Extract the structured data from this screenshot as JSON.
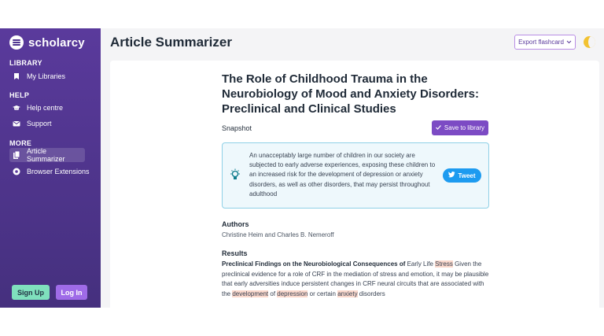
{
  "brand": {
    "name": "scholarcy"
  },
  "sidebar": {
    "library_head": "LIBRARY",
    "help_head": "HELP",
    "more_head": "MORE",
    "items": [
      {
        "label": "My Libraries",
        "icon": "bookmark-icon"
      },
      {
        "label": "Help centre",
        "icon": "graduation-cap-icon"
      },
      {
        "label": "Support",
        "icon": "mail-icon"
      },
      {
        "label": "Article Summarizer",
        "icon": "documents-icon",
        "active": true
      },
      {
        "label": "Browser Extensions",
        "icon": "chrome-icon"
      }
    ],
    "signup_label": "Sign Up",
    "login_label": "Log In"
  },
  "header": {
    "title": "Article Summarizer",
    "export_label": "Export flashcard",
    "theme_icon": "moon-icon"
  },
  "article": {
    "title": "The Role of Childhood Trauma in the Neurobiology of Mood and Anxiety Disorders: Preclinical and Clinical Studies",
    "snapshot_label": "Snapshot",
    "save_label": "Save to library",
    "snapshot_text": "An unacceptably large number of children in our society are subjected to early adverse experiences, exposing these children to an increased risk for the development of depression or anxiety disorders, as well as other disorders, that may persist throughout adulthood",
    "tweet_label": "Tweet",
    "authors_head": "Authors",
    "authors": "Christine Heim and Charles B. Nemeroff",
    "results_head": "Results",
    "results": {
      "bold": "Preclinical Findings on the Neurobiological Consequences of",
      "t1": " Early Life ",
      "h1": "Stress",
      "t2": " Given the preclinical evidence for a role of CRF in the mediation of stress and emotion, it may be plausible that early adversities induce persistent changes in CRF neural circuits that are associated with the ",
      "h2": "development",
      "t3": " of ",
      "h3": "depression",
      "t4": " or certain ",
      "h4": "anxiety",
      "t5": " disorders"
    }
  },
  "colors": {
    "sidebar": "#4e3490",
    "accent": "#7c4bc4",
    "tweet": "#1d9bf0",
    "highlight": "#fbd9cd"
  }
}
